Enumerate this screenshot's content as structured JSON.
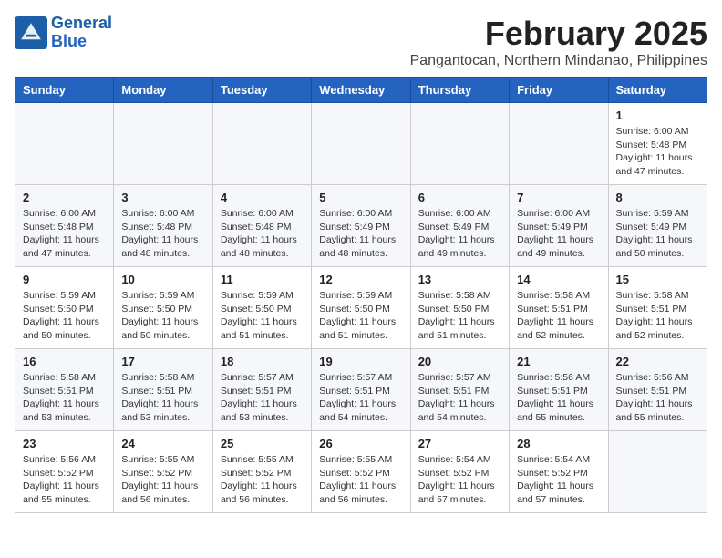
{
  "logo": {
    "line1": "General",
    "line2": "Blue"
  },
  "title": "February 2025",
  "location": "Pangantocan, Northern Mindanao, Philippines",
  "weekdays": [
    "Sunday",
    "Monday",
    "Tuesday",
    "Wednesday",
    "Thursday",
    "Friday",
    "Saturday"
  ],
  "weeks": [
    [
      {
        "day": "",
        "info": ""
      },
      {
        "day": "",
        "info": ""
      },
      {
        "day": "",
        "info": ""
      },
      {
        "day": "",
        "info": ""
      },
      {
        "day": "",
        "info": ""
      },
      {
        "day": "",
        "info": ""
      },
      {
        "day": "1",
        "info": "Sunrise: 6:00 AM\nSunset: 5:48 PM\nDaylight: 11 hours\nand 47 minutes."
      }
    ],
    [
      {
        "day": "2",
        "info": "Sunrise: 6:00 AM\nSunset: 5:48 PM\nDaylight: 11 hours\nand 47 minutes."
      },
      {
        "day": "3",
        "info": "Sunrise: 6:00 AM\nSunset: 5:48 PM\nDaylight: 11 hours\nand 48 minutes."
      },
      {
        "day": "4",
        "info": "Sunrise: 6:00 AM\nSunset: 5:48 PM\nDaylight: 11 hours\nand 48 minutes."
      },
      {
        "day": "5",
        "info": "Sunrise: 6:00 AM\nSunset: 5:49 PM\nDaylight: 11 hours\nand 48 minutes."
      },
      {
        "day": "6",
        "info": "Sunrise: 6:00 AM\nSunset: 5:49 PM\nDaylight: 11 hours\nand 49 minutes."
      },
      {
        "day": "7",
        "info": "Sunrise: 6:00 AM\nSunset: 5:49 PM\nDaylight: 11 hours\nand 49 minutes."
      },
      {
        "day": "8",
        "info": "Sunrise: 5:59 AM\nSunset: 5:49 PM\nDaylight: 11 hours\nand 50 minutes."
      }
    ],
    [
      {
        "day": "9",
        "info": "Sunrise: 5:59 AM\nSunset: 5:50 PM\nDaylight: 11 hours\nand 50 minutes."
      },
      {
        "day": "10",
        "info": "Sunrise: 5:59 AM\nSunset: 5:50 PM\nDaylight: 11 hours\nand 50 minutes."
      },
      {
        "day": "11",
        "info": "Sunrise: 5:59 AM\nSunset: 5:50 PM\nDaylight: 11 hours\nand 51 minutes."
      },
      {
        "day": "12",
        "info": "Sunrise: 5:59 AM\nSunset: 5:50 PM\nDaylight: 11 hours\nand 51 minutes."
      },
      {
        "day": "13",
        "info": "Sunrise: 5:58 AM\nSunset: 5:50 PM\nDaylight: 11 hours\nand 51 minutes."
      },
      {
        "day": "14",
        "info": "Sunrise: 5:58 AM\nSunset: 5:51 PM\nDaylight: 11 hours\nand 52 minutes."
      },
      {
        "day": "15",
        "info": "Sunrise: 5:58 AM\nSunset: 5:51 PM\nDaylight: 11 hours\nand 52 minutes."
      }
    ],
    [
      {
        "day": "16",
        "info": "Sunrise: 5:58 AM\nSunset: 5:51 PM\nDaylight: 11 hours\nand 53 minutes."
      },
      {
        "day": "17",
        "info": "Sunrise: 5:58 AM\nSunset: 5:51 PM\nDaylight: 11 hours\nand 53 minutes."
      },
      {
        "day": "18",
        "info": "Sunrise: 5:57 AM\nSunset: 5:51 PM\nDaylight: 11 hours\nand 53 minutes."
      },
      {
        "day": "19",
        "info": "Sunrise: 5:57 AM\nSunset: 5:51 PM\nDaylight: 11 hours\nand 54 minutes."
      },
      {
        "day": "20",
        "info": "Sunrise: 5:57 AM\nSunset: 5:51 PM\nDaylight: 11 hours\nand 54 minutes."
      },
      {
        "day": "21",
        "info": "Sunrise: 5:56 AM\nSunset: 5:51 PM\nDaylight: 11 hours\nand 55 minutes."
      },
      {
        "day": "22",
        "info": "Sunrise: 5:56 AM\nSunset: 5:51 PM\nDaylight: 11 hours\nand 55 minutes."
      }
    ],
    [
      {
        "day": "23",
        "info": "Sunrise: 5:56 AM\nSunset: 5:52 PM\nDaylight: 11 hours\nand 55 minutes."
      },
      {
        "day": "24",
        "info": "Sunrise: 5:55 AM\nSunset: 5:52 PM\nDaylight: 11 hours\nand 56 minutes."
      },
      {
        "day": "25",
        "info": "Sunrise: 5:55 AM\nSunset: 5:52 PM\nDaylight: 11 hours\nand 56 minutes."
      },
      {
        "day": "26",
        "info": "Sunrise: 5:55 AM\nSunset: 5:52 PM\nDaylight: 11 hours\nand 56 minutes."
      },
      {
        "day": "27",
        "info": "Sunrise: 5:54 AM\nSunset: 5:52 PM\nDaylight: 11 hours\nand 57 minutes."
      },
      {
        "day": "28",
        "info": "Sunrise: 5:54 AM\nSunset: 5:52 PM\nDaylight: 11 hours\nand 57 minutes."
      },
      {
        "day": "",
        "info": ""
      }
    ]
  ]
}
